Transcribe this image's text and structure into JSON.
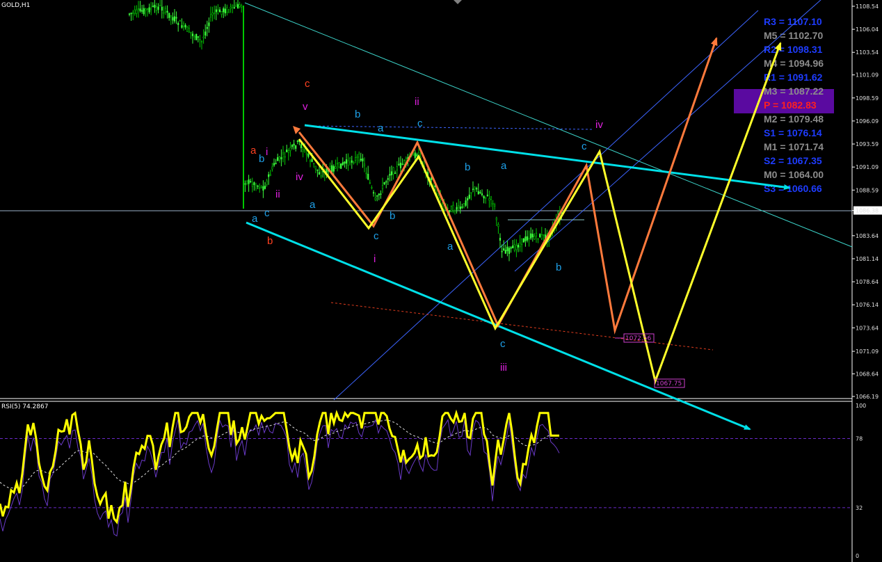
{
  "symbol": "GOLD,H1",
  "rsi_title": "RSI(5) 74.2867",
  "colors": {
    "bg": "#000000",
    "candle_up": "#00c800",
    "candle_down": "#3cff3c",
    "channel": "#00e0e8",
    "orange": "#ff7a3c",
    "yellow": "#ffff2a",
    "wave_cyan": "#1ea0e8",
    "wave_magenta": "#e020e0",
    "wave_red": "#ff4020",
    "rsi": "#ffff00"
  },
  "pivots": [
    {
      "label": "R3 = 1107.10",
      "color": "#1e3cff"
    },
    {
      "label": "M5 = 1102.70",
      "color": "#8c8c8c"
    },
    {
      "label": "R2 = 1098.31",
      "color": "#1e3cff"
    },
    {
      "label": "M4 = 1094.96",
      "color": "#8c8c8c"
    },
    {
      "label": "R1 = 1091.62",
      "color": "#1e3cff"
    },
    {
      "label": "M3 = 1087.22",
      "color": "#8c8c8c"
    },
    {
      "label": "P  = 1082.83",
      "color": "#ff2020"
    },
    {
      "label": "M2 = 1079.48",
      "color": "#8c8c8c"
    },
    {
      "label": "S1 = 1076.14",
      "color": "#1e3cff"
    },
    {
      "label": "M1 = 1071.74",
      "color": "#8c8c8c"
    },
    {
      "label": "S2 = 1067.35",
      "color": "#1e3cff"
    },
    {
      "label": "M0 = 1064.00",
      "color": "#8c8c8c"
    },
    {
      "label": "S3 = 1060.66",
      "color": "#1e3cff"
    }
  ],
  "chart_data": [
    {
      "type": "candlestick",
      "title": "GOLD,H1",
      "price_ticks": [
        "1108.54",
        "1106.04",
        "1103.54",
        "1101.09",
        "1098.59",
        "1096.09",
        "1093.59",
        "1091.09",
        "1088.59",
        "1086.38",
        "1083.64",
        "1081.14",
        "1078.64",
        "1076.14",
        "1073.64",
        "1071.09",
        "1068.64",
        "1066.19"
      ],
      "current_price": "1086.38",
      "target_labels": [
        "1072.56",
        "1067.75"
      ],
      "wave_labels": [
        {
          "t": "a",
          "color": "wave_red"
        },
        {
          "t": "b",
          "color": "wave_red"
        },
        {
          "t": "c",
          "color": "wave_red"
        },
        {
          "t": "i",
          "color": "wave_magenta"
        },
        {
          "t": "ii",
          "color": "wave_magenta"
        },
        {
          "t": "iii",
          "color": "wave_magenta"
        },
        {
          "t": "iv",
          "color": "wave_magenta"
        },
        {
          "t": "v",
          "color": "wave_magenta"
        },
        {
          "t": "a",
          "color": "wave_cyan"
        },
        {
          "t": "b",
          "color": "wave_cyan"
        },
        {
          "t": "c",
          "color": "wave_cyan"
        }
      ],
      "ylim": [
        1066.19,
        1108.54
      ]
    },
    {
      "type": "line",
      "title": "RSI(5) 74.2867",
      "series": [
        {
          "name": "RSI(5)",
          "last": 74.2867
        }
      ],
      "levels": [
        78,
        32
      ],
      "axis_ticks": [
        "100",
        "78",
        "32",
        "0"
      ],
      "ylim": [
        0,
        100
      ]
    }
  ]
}
